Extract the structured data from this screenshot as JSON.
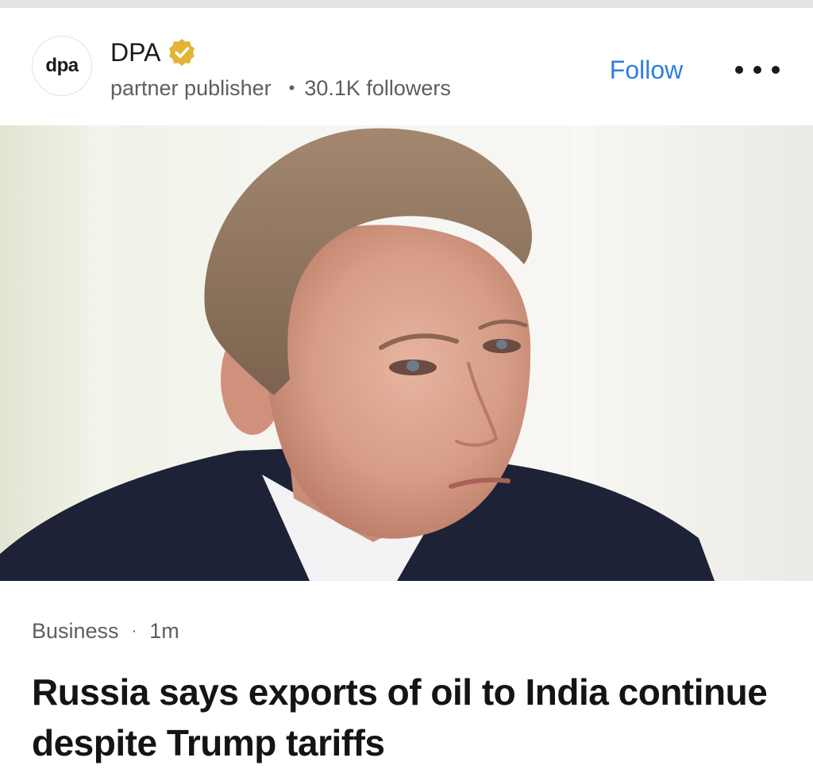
{
  "publisher": {
    "avatar_text": "dpa",
    "name": "DPA",
    "verified_icon": "verified-badge-icon",
    "type": "partner publisher",
    "followers": "30.1K followers",
    "follow_label": "Follow",
    "more_icon": "more-horizontal-icon"
  },
  "article": {
    "image_description_icon": "news-photo",
    "category": "Business",
    "time": "1m",
    "headline": "Russia says exports of oil to India continue despite Trump tariffs"
  },
  "colors": {
    "accent": "#2f7de1",
    "verified_badge": "#e2b538",
    "text_primary": "#141414",
    "text_secondary": "#5e5e5e"
  }
}
